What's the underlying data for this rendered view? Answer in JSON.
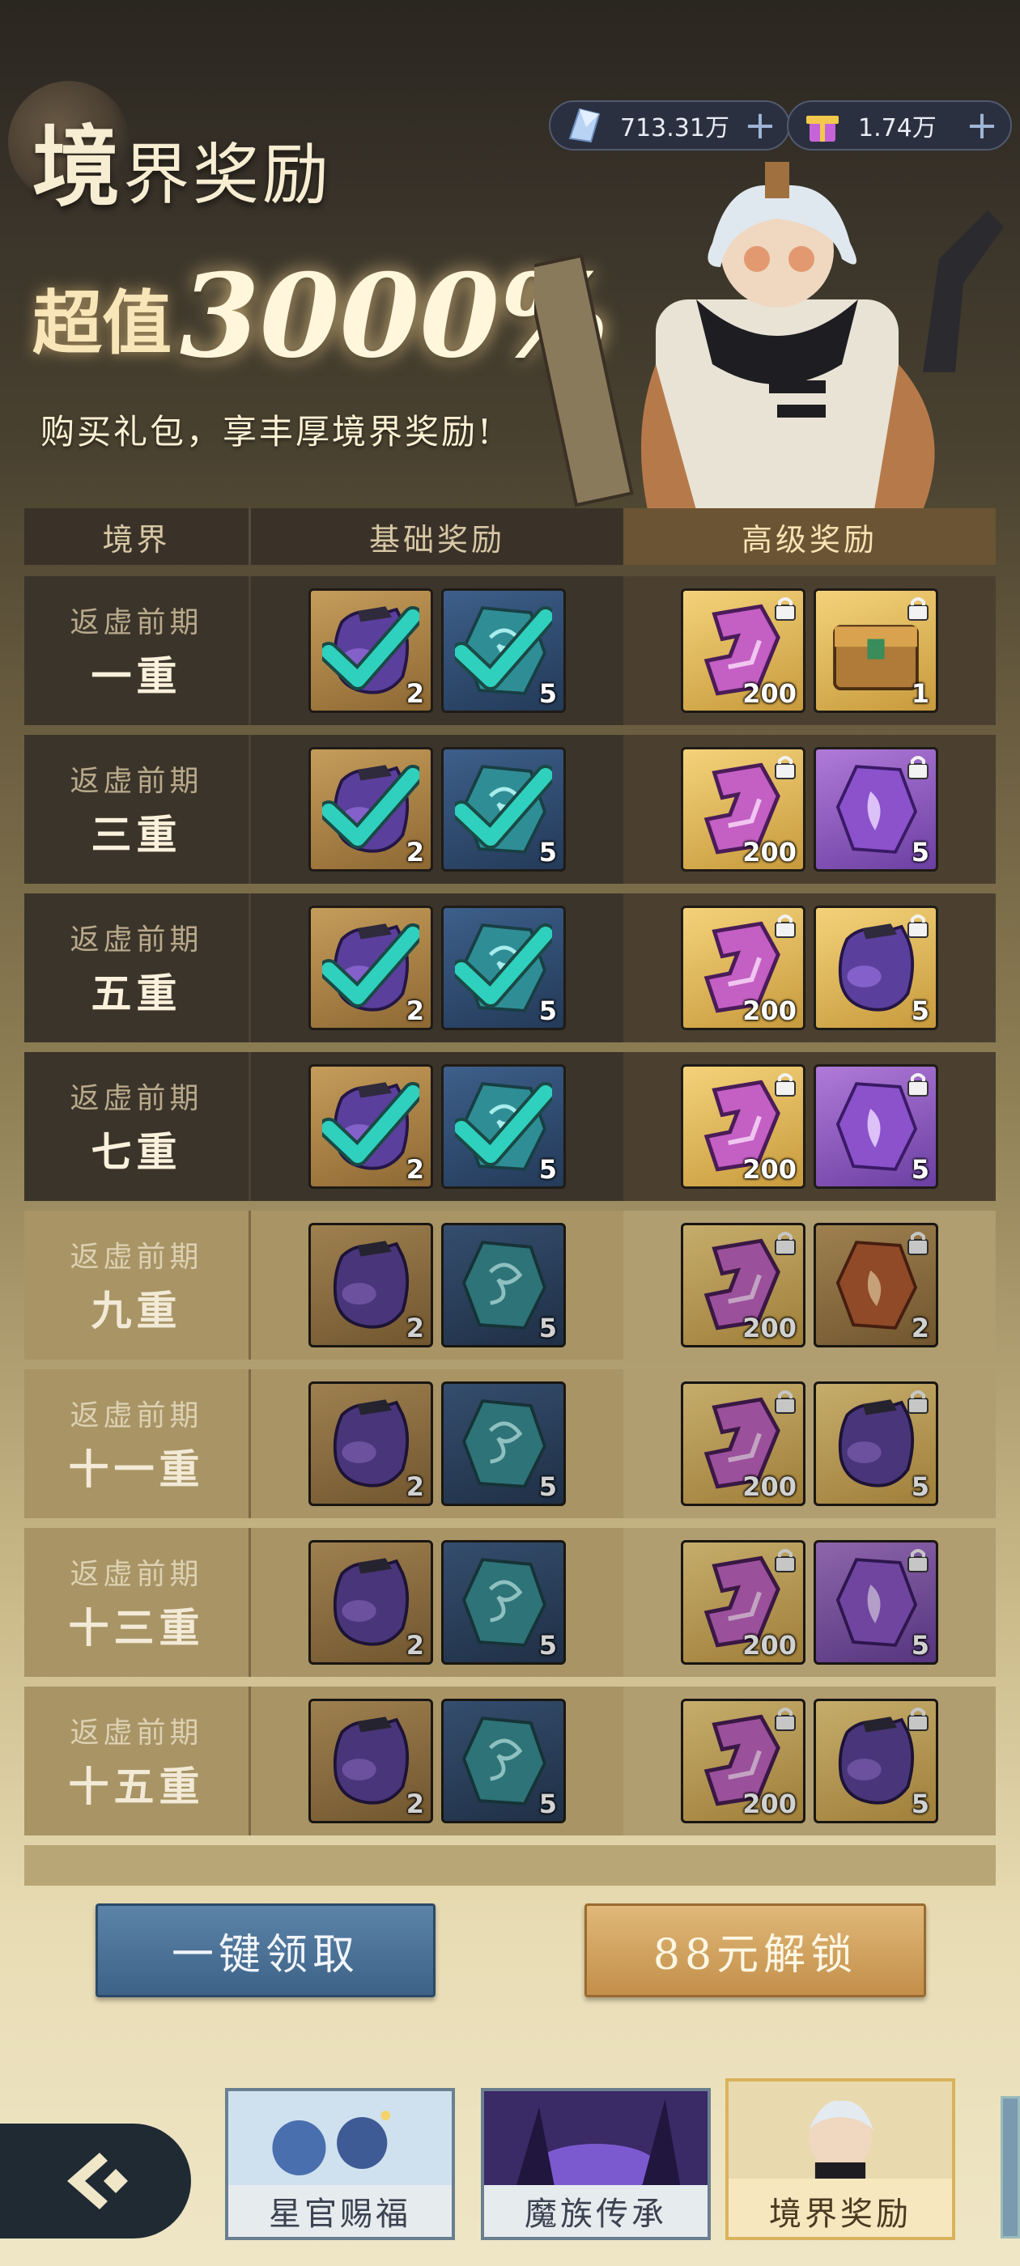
{
  "header": {
    "title_big": "境",
    "title_rest": "界奖励",
    "promo_prefix": "超值",
    "promo_value": "3000%",
    "promo_desc": "购买礼包，享丰厚境界奖励!"
  },
  "currencies": [
    {
      "icon": "crystal-icon",
      "value": "713.31万",
      "plus": "+"
    },
    {
      "icon": "gift-icon",
      "value": "1.74万",
      "plus": "+"
    }
  ],
  "table": {
    "headers": [
      "境界",
      "基础奖励",
      "高级奖励"
    ],
    "rows": [
      {
        "realm": "返虚前期",
        "level": "一重",
        "state": "claimed",
        "basic": [
          {
            "icon": "pouch-icon",
            "qty": "2"
          },
          {
            "icon": "jade-icon",
            "qty": "5"
          }
        ],
        "premium": [
          {
            "icon": "talisman-icon",
            "qty": "200"
          },
          {
            "icon": "chest-icon",
            "qty": "1"
          }
        ]
      },
      {
        "realm": "返虚前期",
        "level": "三重",
        "state": "claimed",
        "basic": [
          {
            "icon": "pouch-icon",
            "qty": "2"
          },
          {
            "icon": "jade-icon",
            "qty": "5"
          }
        ],
        "premium": [
          {
            "icon": "talisman-icon",
            "qty": "200"
          },
          {
            "icon": "purple-gem-icon",
            "qty": "5"
          }
        ]
      },
      {
        "realm": "返虚前期",
        "level": "五重",
        "state": "claimed",
        "basic": [
          {
            "icon": "pouch-icon",
            "qty": "2"
          },
          {
            "icon": "jade-icon",
            "qty": "5"
          }
        ],
        "premium": [
          {
            "icon": "talisman-icon",
            "qty": "200"
          },
          {
            "icon": "pouch-icon",
            "qty": "5"
          }
        ]
      },
      {
        "realm": "返虚前期",
        "level": "七重",
        "state": "claimed",
        "basic": [
          {
            "icon": "pouch-icon",
            "qty": "2"
          },
          {
            "icon": "jade-icon",
            "qty": "5"
          }
        ],
        "premium": [
          {
            "icon": "talisman-icon",
            "qty": "200"
          },
          {
            "icon": "purple-gem-icon",
            "qty": "5"
          }
        ]
      },
      {
        "realm": "返虚前期",
        "level": "九重",
        "state": "locked",
        "basic": [
          {
            "icon": "pouch-icon",
            "qty": "2"
          },
          {
            "icon": "jade-icon",
            "qty": "5"
          }
        ],
        "premium": [
          {
            "icon": "talisman-icon",
            "qty": "200"
          },
          {
            "icon": "amber-gem-icon",
            "qty": "2"
          }
        ]
      },
      {
        "realm": "返虚前期",
        "level": "十一重",
        "state": "locked",
        "basic": [
          {
            "icon": "pouch-icon",
            "qty": "2"
          },
          {
            "icon": "jade-icon",
            "qty": "5"
          }
        ],
        "premium": [
          {
            "icon": "talisman-icon",
            "qty": "200"
          },
          {
            "icon": "pouch-icon",
            "qty": "5"
          }
        ]
      },
      {
        "realm": "返虚前期",
        "level": "十三重",
        "state": "locked",
        "basic": [
          {
            "icon": "pouch-icon",
            "qty": "2"
          },
          {
            "icon": "jade-icon",
            "qty": "5"
          }
        ],
        "premium": [
          {
            "icon": "talisman-icon",
            "qty": "200"
          },
          {
            "icon": "purple-gem-icon",
            "qty": "5"
          }
        ]
      },
      {
        "realm": "返虚前期",
        "level": "十五重",
        "state": "locked",
        "basic": [
          {
            "icon": "pouch-icon",
            "qty": "2"
          },
          {
            "icon": "jade-icon",
            "qty": "5"
          }
        ],
        "premium": [
          {
            "icon": "talisman-icon",
            "qty": "200"
          },
          {
            "icon": "pouch-icon",
            "qty": "5"
          }
        ]
      }
    ]
  },
  "buttons": {
    "claim_all": "一键领取",
    "unlock": "88元解锁"
  },
  "nav": {
    "tabs": [
      {
        "label": "星官赐福",
        "active": false
      },
      {
        "label": "魔族传承",
        "active": false
      },
      {
        "label": "境界奖励",
        "active": true
      }
    ]
  },
  "colors": {
    "claimed_check": "#2fd0bd",
    "unlock_button": "#d4a460",
    "claim_button": "#4f769c"
  }
}
